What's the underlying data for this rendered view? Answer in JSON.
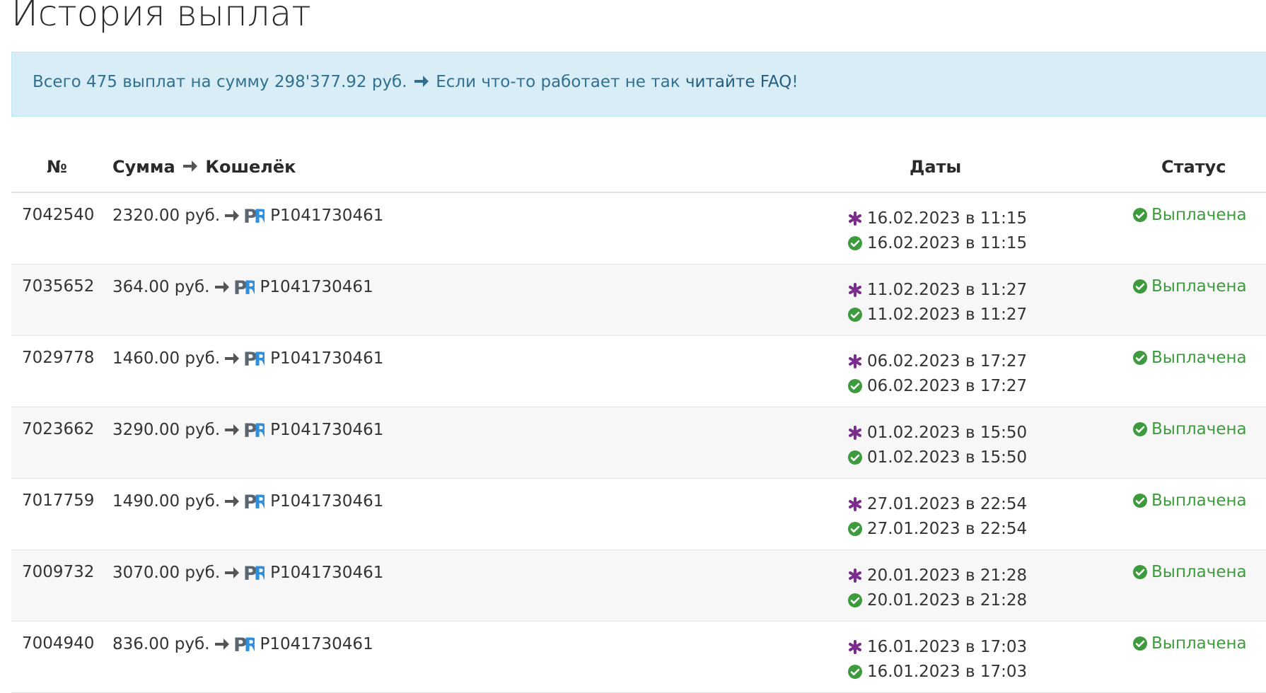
{
  "page": {
    "title": "История выплат"
  },
  "info": {
    "summary_text": "Всего 475 выплат на сумму 298'377.92 руб.",
    "notice_text": "Если что-то работает не так",
    "faq_link": "читайте FAQ",
    "suffix": "!"
  },
  "table": {
    "headers": {
      "number": "№",
      "sum": "Сумма",
      "wallet": "Кошелёк",
      "dates": "Даты",
      "status": "Статус"
    },
    "wallet_logo": "PR",
    "date_separator": "в",
    "rows": [
      {
        "id": "7042540",
        "amount": "2320.00 руб.",
        "wallet": "P1041730461",
        "created": "16.02.2023 в 11:15",
        "paid": "16.02.2023 в 11:15",
        "status": "Выплачена"
      },
      {
        "id": "7035652",
        "amount": "364.00 руб.",
        "wallet": "P1041730461",
        "created": "11.02.2023 в 11:27",
        "paid": "11.02.2023 в 11:27",
        "status": "Выплачена"
      },
      {
        "id": "7029778",
        "amount": "1460.00 руб.",
        "wallet": "P1041730461",
        "created": "06.02.2023 в 17:27",
        "paid": "06.02.2023 в 17:27",
        "status": "Выплачена"
      },
      {
        "id": "7023662",
        "amount": "3290.00 руб.",
        "wallet": "P1041730461",
        "created": "01.02.2023 в 15:50",
        "paid": "01.02.2023 в 15:50",
        "status": "Выплачена"
      },
      {
        "id": "7017759",
        "amount": "1490.00 руб.",
        "wallet": "P1041730461",
        "created": "27.01.2023 в 22:54",
        "paid": "27.01.2023 в 22:54",
        "status": "Выплачена"
      },
      {
        "id": "7009732",
        "amount": "3070.00 руб.",
        "wallet": "P1041730461",
        "created": "20.01.2023 в 21:28",
        "paid": "20.01.2023 в 21:28",
        "status": "Выплачена"
      },
      {
        "id": "7004940",
        "amount": "836.00 руб.",
        "wallet": "P1041730461",
        "created": "16.01.2023 в 17:03",
        "paid": "16.01.2023 в 17:03",
        "status": "Выплачена"
      }
    ]
  },
  "colors": {
    "info_bg": "#d9edf7",
    "info_text": "#31708f",
    "status_paid": "#3d9b3d",
    "created_icon": "#7b2d8e",
    "paid_icon": "#3d9b3d",
    "pr_p": "#5a6570",
    "pr_r": "#2f8fdc"
  },
  "icons": {
    "arrow": "arrow-right-icon",
    "created": "asterisk-icon",
    "paid": "check-circle-icon",
    "wallet": "payeer-pr-logo-icon"
  }
}
